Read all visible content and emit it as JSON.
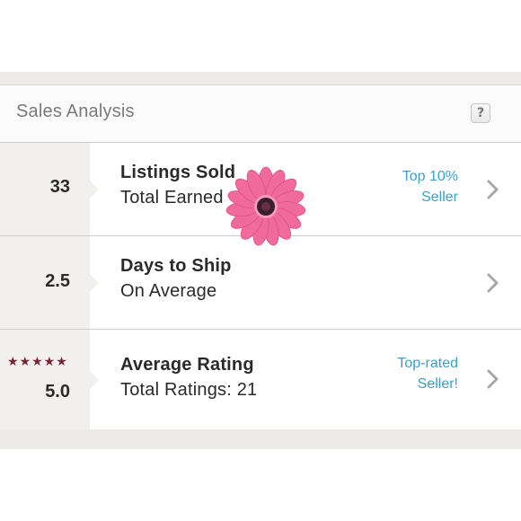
{
  "header": {
    "title": "Sales Analysis",
    "help_label": "?"
  },
  "rows": [
    {
      "value": "33",
      "title": "Listings Sold",
      "subtitle": "Total Earned",
      "badge_line1": "Top 10%",
      "badge_line2": "Seller",
      "icon": "chevron-right-icon"
    },
    {
      "value": "2.5",
      "title": "Days to Ship",
      "subtitle": "On Average",
      "icon": "chevron-right-icon"
    },
    {
      "value": "5.0",
      "stars": "★★★★★",
      "title": "Average Rating",
      "subtitle": "Total Ratings: 21",
      "badge_line1": "Top-rated",
      "badge_line2": "Seller!",
      "icon": "chevron-right-icon"
    }
  ],
  "decoration": {
    "sticker": "flower-icon"
  },
  "colors": {
    "accent_blue": "#3aa0c8",
    "star_maroon": "#7a2433",
    "stat_column": "#f1f0ee",
    "flower_pink": "#f06b9a",
    "flower_center": "#3a1f2a"
  }
}
